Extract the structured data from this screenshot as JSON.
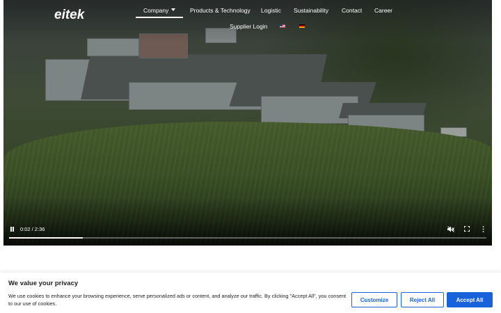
{
  "brand": {
    "logo_text": "eitek"
  },
  "nav": {
    "items": [
      "Company",
      "Products & Technology",
      "Logistic",
      "Sustainability",
      "Contact",
      "Career"
    ],
    "supplier_login": "Supplier Login",
    "languages": [
      "english-flag-icon",
      "german-flag-icon"
    ],
    "active": "Company"
  },
  "video": {
    "time_label": "0:02 / 2:36",
    "progress_fraction": 0.155,
    "icons": [
      "pause-icon",
      "mute-icon",
      "fullscreen-icon",
      "more-options-icon"
    ]
  },
  "cookie": {
    "title": "We value your privacy",
    "text": "We use cookies to enhance your browsing experience, serve personalized ads or content, and analyze our traffic. By clicking \"Accept All\", you consent to our use of cookies.",
    "customize_label": "Customize",
    "reject_label": "Reject All",
    "accept_label": "Accept All"
  },
  "colors": {
    "accent": "#1863dc",
    "text": "#212121"
  }
}
